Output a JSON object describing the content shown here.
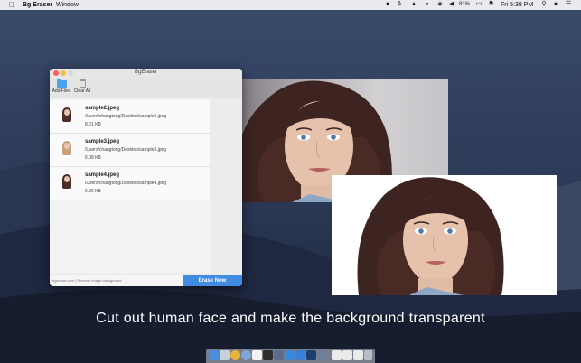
{
  "menubar": {
    "app_name": "Bg Eraser",
    "menus": [
      "Window"
    ],
    "status": {
      "battery": "81%",
      "time": "Fri 5:39 PM"
    }
  },
  "window": {
    "title": "BgEraser",
    "toolbar": {
      "add_files": "Add Files",
      "clear_all": "Clear All"
    },
    "files": [
      {
        "name": "sample2.jpeg",
        "path": "/Users/changtong/Desktop/sample2.jpeg",
        "size": "8.01 KB"
      },
      {
        "name": "sample3.jpeg",
        "path": "/Users/changtong/Desktop/sample3.jpeg",
        "size": "6.08 KB"
      },
      {
        "name": "sample4.jpeg",
        "path": "/Users/changtong/Desktop/sample4.jpeg",
        "size": "6.96 KB"
      }
    ],
    "footer_text": "bgeraser.com | Remove image background",
    "erase_button": "Erase Now"
  },
  "caption": "Cut out human face and make the background transparent",
  "colors": {
    "accent": "#3f8ce0",
    "desktop": "#1c2436"
  }
}
